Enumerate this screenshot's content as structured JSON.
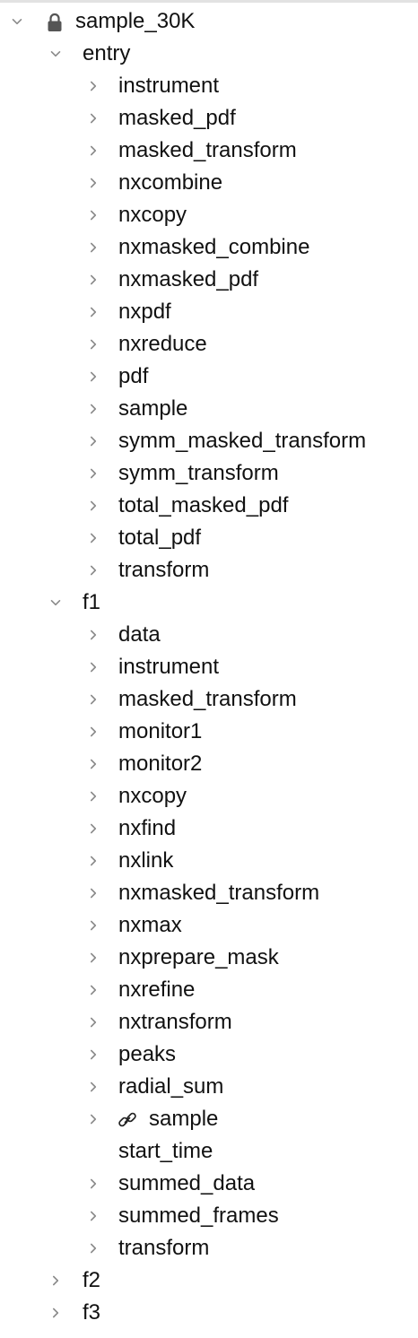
{
  "tree": {
    "root": {
      "label": "sample_30K",
      "expanded": true,
      "icon": "lock-icon"
    },
    "groups": [
      {
        "label": "entry",
        "expanded": true,
        "children": [
          "instrument",
          "masked_pdf",
          "masked_transform",
          "nxcombine",
          "nxcopy",
          "nxmasked_combine",
          "nxmasked_pdf",
          "nxpdf",
          "nxreduce",
          "pdf",
          "sample",
          "symm_masked_transform",
          "symm_transform",
          "total_masked_pdf",
          "total_pdf",
          "transform"
        ]
      },
      {
        "label": "f1",
        "expanded": true,
        "children": [
          "data",
          "instrument",
          "masked_transform",
          "monitor1",
          "monitor2",
          "nxcopy",
          "nxfind",
          "nxlink",
          "nxmasked_transform",
          "nxmax",
          "nxprepare_mask",
          "nxrefine",
          "nxtransform",
          "peaks",
          "radial_sum",
          "sample",
          "start_time",
          "summed_data",
          "summed_frames",
          "transform"
        ],
        "linked_child": "sample",
        "leaf_child": "start_time"
      },
      {
        "label": "f2",
        "expanded": false,
        "children": []
      },
      {
        "label": "f3",
        "expanded": false,
        "children": []
      }
    ],
    "icons": {
      "expanded": "chevron-down-icon",
      "collapsed": "chevron-right-icon",
      "link": "link-icon"
    }
  }
}
